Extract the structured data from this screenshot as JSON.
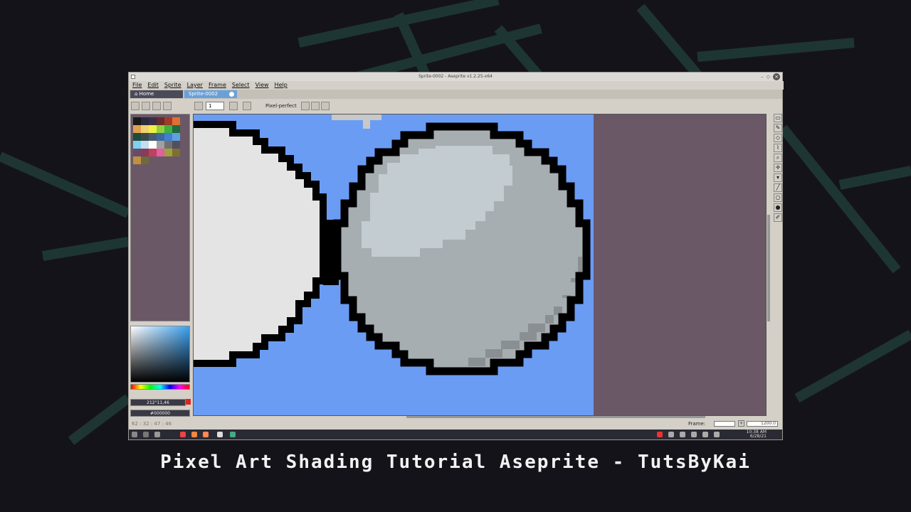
{
  "window": {
    "title": "Sprite-0002 - Aseprite v1.2.25-x64",
    "controls": {
      "minimize": "–",
      "maximize": "◇",
      "close": "×"
    }
  },
  "menu": [
    "File",
    "Edit",
    "Sprite",
    "Layer",
    "Frame",
    "Select",
    "View",
    "Help"
  ],
  "tabs": [
    {
      "label": "Home",
      "active": false
    },
    {
      "label": "Sprite-0002",
      "active": true
    }
  ],
  "context_bar": {
    "brush_size": "1",
    "pixel_perfect_label": "Pixel-perfect"
  },
  "palette": {
    "swatches": [
      "#1a1a1a",
      "#2a2a3a",
      "#3a2e4a",
      "#6a2a2a",
      "#a03a2a",
      "#e07030",
      "#e0a050",
      "#f0d070",
      "#f0f040",
      "#90d040",
      "#40b040",
      "#206a40",
      "#204a3a",
      "#3a4a4a",
      "#4a5a70",
      "#3a6aa0",
      "#4080d0",
      "#60a0e0",
      "#80d0f0",
      "#c0e0f0",
      "#ffffff",
      "#a0a0a0",
      "#707070",
      "#505060",
      "#6a4a6a",
      "#8a3a5a",
      "#c04060",
      "#e060a0",
      "#a0a040",
      "#807030",
      "#c09040",
      "#706a3a"
    ]
  },
  "color_readout": {
    "value": "212°11,46",
    "hex": "#000000"
  },
  "status": {
    "coords": "62 : 32    :    47 : 46",
    "frame_label": "Frame:",
    "zoom": "1200.0"
  },
  "taskbar": {
    "time": "10:38 AM",
    "date": "6/28/21"
  },
  "caption": "Pixel Art Shading Tutorial Aseprite - TutsByKai",
  "colors": {
    "canvas_bg": "#6a9cf4",
    "workspace": "#6a5866",
    "sphere_mid": "#a7aeb2",
    "sphere_light": "#c3ccd0",
    "sphere_dark": "#8a8f93",
    "left_ball": "#e4e4e4",
    "outline": "#000000"
  }
}
